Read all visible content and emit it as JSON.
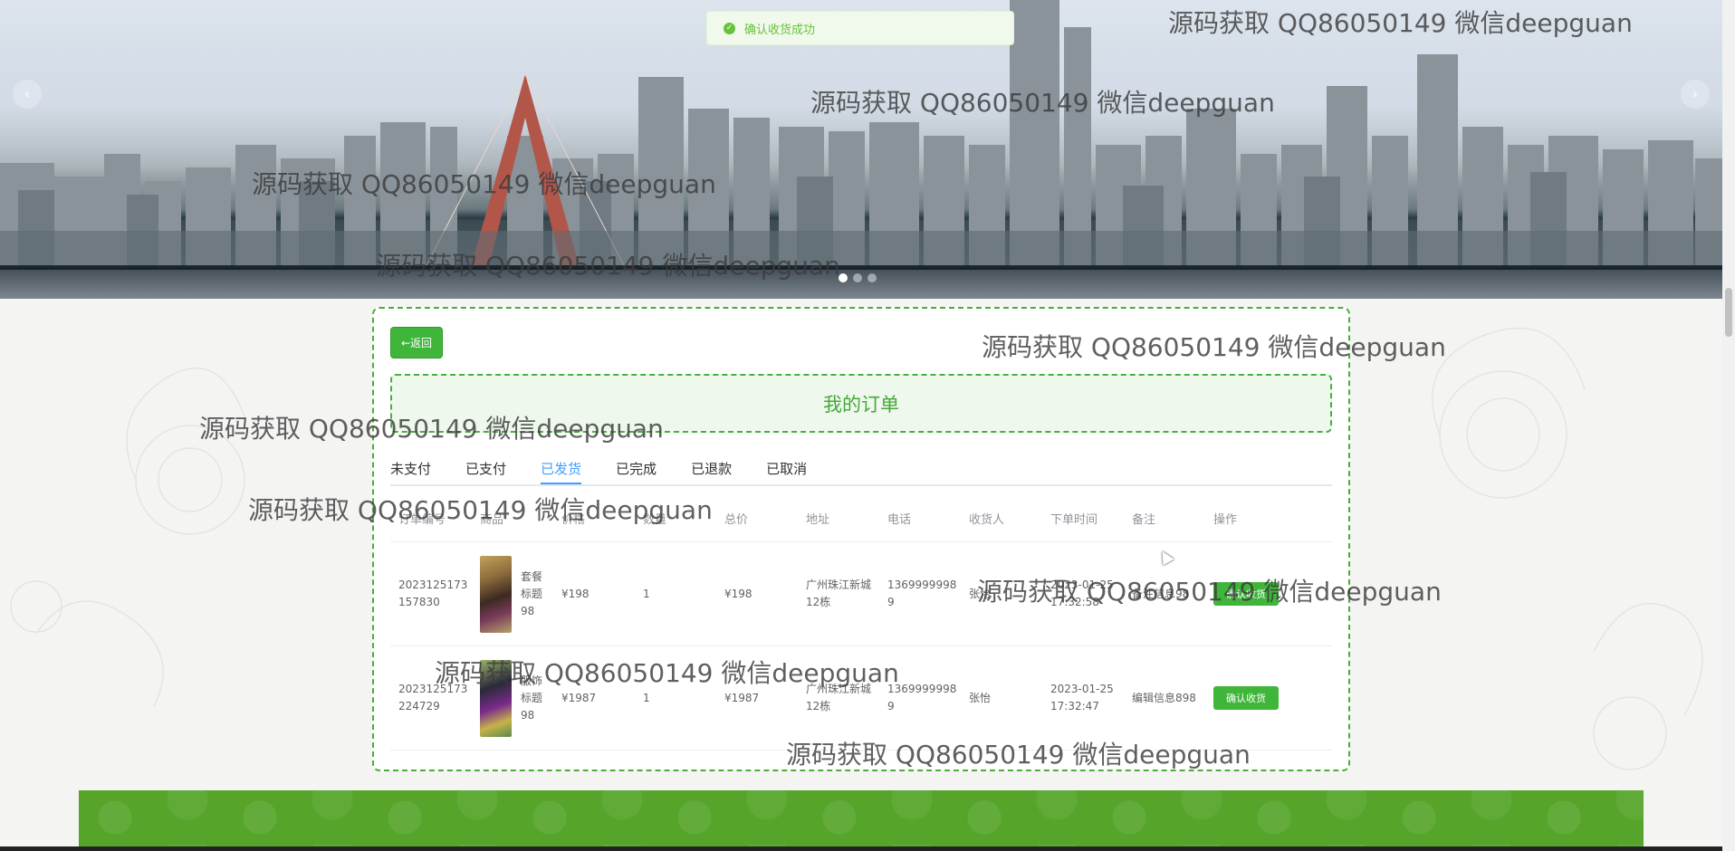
{
  "toast": {
    "message": "确认收货成功",
    "icon": "success-check-icon"
  },
  "banner": {
    "dots": 3,
    "active_dot": 0
  },
  "back_button": {
    "label": "←返回"
  },
  "page_title": "我的订单",
  "tabs": [
    {
      "label": "未支付",
      "active": false
    },
    {
      "label": "已支付",
      "active": false
    },
    {
      "label": "已发货",
      "active": true
    },
    {
      "label": "已完成",
      "active": false
    },
    {
      "label": "已退款",
      "active": false
    },
    {
      "label": "已取消",
      "active": false
    }
  ],
  "table": {
    "headers": [
      "订单编号",
      "商品",
      "价格",
      "数量",
      "总价",
      "地址",
      "电话",
      "收货人",
      "下单时间",
      "备注",
      "操作"
    ],
    "rows": [
      {
        "order_no": "2023125173157830",
        "product_name": "套餐标题98",
        "price": "¥198",
        "quantity": "1",
        "total": "¥198",
        "address": "广州珠江新城12栋",
        "phone": "13699999989",
        "receiver": "张怡",
        "time": "2023-01-25 17:32:58",
        "remark": "备注信息98",
        "action": "确认收货"
      },
      {
        "order_no": "2023125173224729",
        "product_name": "服饰标题98",
        "price": "¥1987",
        "quantity": "1",
        "total": "¥1987",
        "address": "广州珠江新城12栋",
        "phone": "13699999989",
        "receiver": "张怡",
        "time": "2023-01-25 17:32:47",
        "remark": "编辑信息898",
        "action": "确认收货"
      }
    ]
  },
  "watermark": "源码获取 QQ86050149 微信deepguan"
}
